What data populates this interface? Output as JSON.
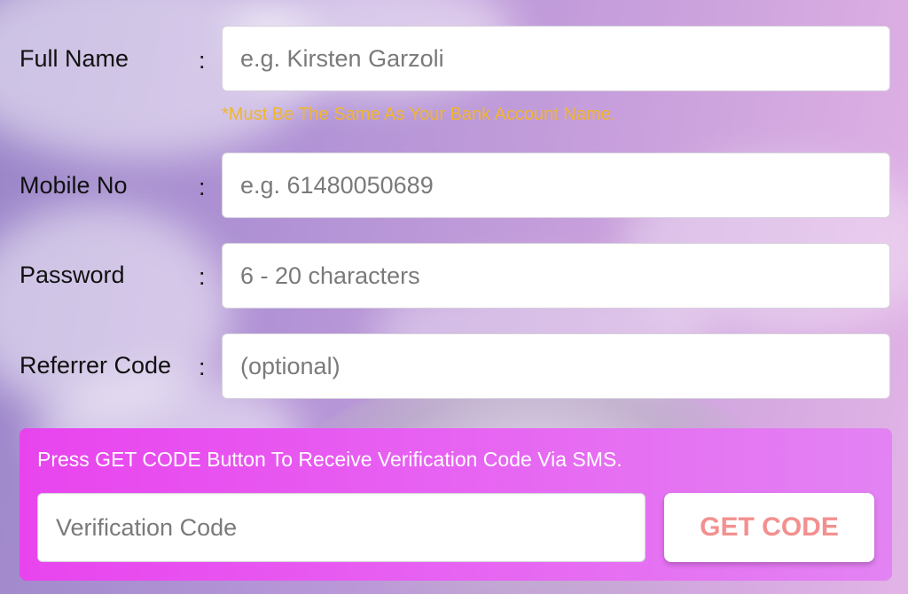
{
  "form": {
    "full_name": {
      "label": "Full Name",
      "colon": ":",
      "placeholder": "e.g. Kirsten Garzoli",
      "hint": "*Must Be The Same As Your Bank Account Name."
    },
    "mobile": {
      "label": "Mobile No",
      "colon": ":",
      "placeholder": "e.g. 61480050689"
    },
    "password": {
      "label": "Password",
      "colon": ":",
      "placeholder": "6 - 20 characters"
    },
    "referrer": {
      "label": "Referrer Code",
      "colon": ":",
      "placeholder": "(optional)"
    }
  },
  "verification": {
    "instruction": "Press GET CODE Button To Receive Verification Code Via SMS.",
    "placeholder": "Verification Code",
    "button_label": "GET CODE"
  },
  "colors": {
    "hint": "#f0b62a",
    "panel_start": "#e844ee",
    "panel_end": "#e383f3",
    "button_text": "#f3908f"
  }
}
